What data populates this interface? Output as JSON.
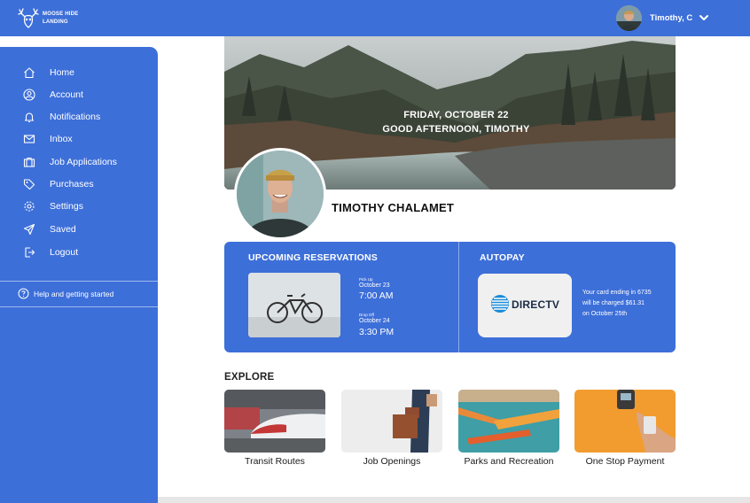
{
  "brand": {
    "name": "MOOSE HIDE\nLANDING"
  },
  "user": {
    "display_name": "Timothy, C",
    "full_name": "TIMOTHY CHALAMET"
  },
  "sidebar": {
    "items": [
      {
        "label": "Home",
        "icon": "home-icon"
      },
      {
        "label": "Account",
        "icon": "user-circle-icon"
      },
      {
        "label": "Notifications",
        "icon": "bell-icon"
      },
      {
        "label": "Inbox",
        "icon": "mail-icon"
      },
      {
        "label": "Job Applications",
        "icon": "briefcase-icon"
      },
      {
        "label": "Purchases",
        "icon": "tag-icon"
      },
      {
        "label": "Settings",
        "icon": "gear-icon"
      },
      {
        "label": "Saved",
        "icon": "send-icon"
      },
      {
        "label": "Logout",
        "icon": "logout-icon"
      }
    ],
    "help": "Help and getting started"
  },
  "hero": {
    "date": "FRIDAY, OCTOBER 22",
    "greeting": "GOOD AFTERNOON, TIMOTHY"
  },
  "reservations": {
    "title": "UPCOMING RESERVATIONS",
    "pickup_label": "Pick Up",
    "pickup_date": "October 23",
    "pickup_time": "7:00 AM",
    "dropoff_label": "Drop Off",
    "dropoff_date": "October 24",
    "dropoff_time": "3:30 PM"
  },
  "autopay": {
    "title": "AUTOPAY",
    "provider": "DIRECTV",
    "line1": "Your card ending in 6735",
    "line2": "will be charged $61.31",
    "line3": "on October 25th"
  },
  "explore": {
    "title": "EXPLORE",
    "tiles": [
      {
        "label": "Transit Routes"
      },
      {
        "label": "Job Openings"
      },
      {
        "label": "Parks and Recreation"
      },
      {
        "label": "One Stop Payment"
      }
    ]
  },
  "colors": {
    "accent": "#3d6fd9",
    "divider": "#9cb8ee"
  }
}
